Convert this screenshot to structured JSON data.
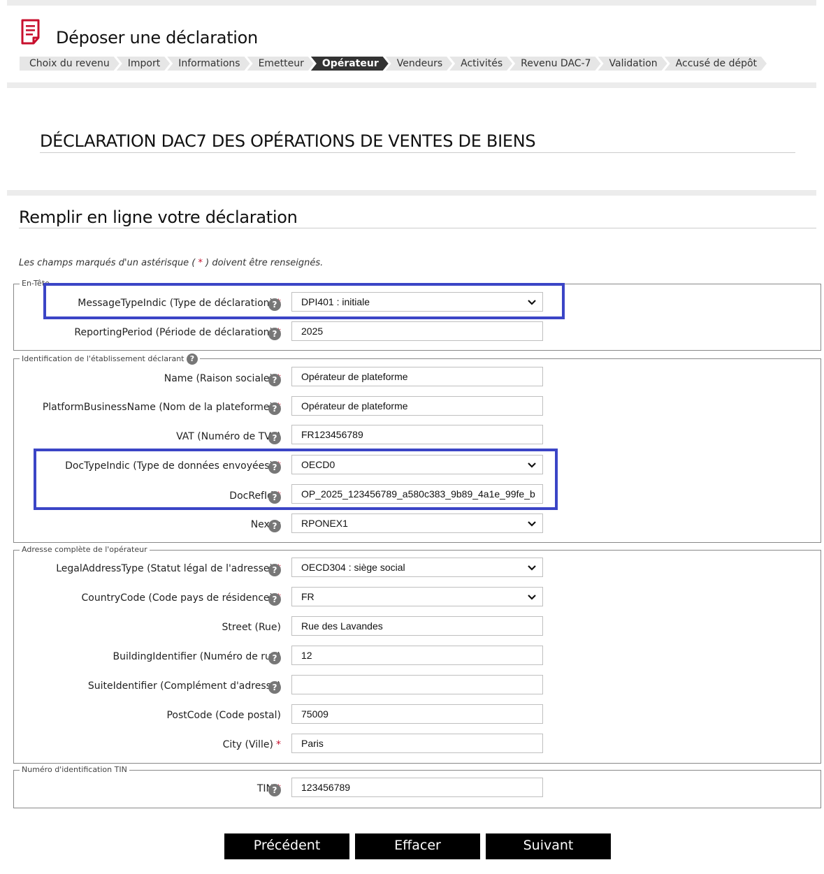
{
  "header": {
    "title": "Déposer une déclaration"
  },
  "steps": [
    {
      "label": "Choix du revenu",
      "active": false
    },
    {
      "label": "Import",
      "active": false
    },
    {
      "label": "Informations",
      "active": false
    },
    {
      "label": "Emetteur",
      "active": false
    },
    {
      "label": "Opérateur",
      "active": true
    },
    {
      "label": "Vendeurs",
      "active": false
    },
    {
      "label": "Activités",
      "active": false
    },
    {
      "label": "Revenu DAC-7",
      "active": false
    },
    {
      "label": "Validation",
      "active": false
    },
    {
      "label": "Accusé de dépôt",
      "active": false
    }
  ],
  "declaration_title": "DÉCLARATION DAC7 DES OPÉRATIONS DE VENTES DE BIENS",
  "form_title": "Remplir en ligne votre déclaration",
  "note": {
    "before": "Les champs marqués d'un astérisque ( ",
    "star": "*",
    "after": " ) doivent être renseignés."
  },
  "sections": {
    "header": {
      "legend": "En-Tête"
    },
    "identification": {
      "legend": "Identification de l'établissement déclarant"
    },
    "address": {
      "legend": "Adresse complète de l'opérateur"
    },
    "tin": {
      "legend": "Numéro d'identification TIN"
    }
  },
  "fields": {
    "message_type": {
      "label": "MessageTypeIndic (Type de déclaration)",
      "value": "DPI401 : initiale"
    },
    "reporting_period": {
      "label": "ReportingPeriod (Période de déclaration)",
      "value": "2025"
    },
    "name": {
      "label": "Name (Raison sociale)",
      "value": "Opérateur de plateforme"
    },
    "platform_business_name": {
      "label": "PlatformBusinessName (Nom de la plateforme)",
      "value": "Opérateur de plateforme"
    },
    "vat": {
      "label": "VAT (Numéro de TVA)",
      "value": "FR123456789"
    },
    "doc_type": {
      "label": "DocTypeIndic (Type de données envoyées)",
      "value": "OECD0"
    },
    "doc_ref": {
      "label": "DocRefId",
      "value": "OP_2025_123456789_a580c383_9b89_4a1e_99fe_b"
    },
    "nexus": {
      "label": "Nexus",
      "value": "RPONEX1"
    },
    "legal_address_type": {
      "label": "LegalAddressType (Statut légal de l'adresse)",
      "value": "OECD304 : siège social"
    },
    "country_code": {
      "label": "CountryCode (Code pays de résidence)",
      "value": "FR"
    },
    "street": {
      "label": "Street (Rue)",
      "value": "Rue des Lavandes"
    },
    "building_identifier": {
      "label": "BuildingIdentifier (Numéro de rue)",
      "value": "12"
    },
    "suite_identifier": {
      "label": "SuiteIdentifier (Complément d'adresse)",
      "value": ""
    },
    "post_code": {
      "label": "PostCode (Code postal)",
      "value": "75009"
    },
    "city": {
      "label": "City (Ville)",
      "value": "Paris"
    },
    "tin": {
      "label": "TIN",
      "value": "123456789"
    }
  },
  "required_mark": "*",
  "help_glyph": "?",
  "buttons": {
    "previous": "Précédent",
    "clear": "Effacer",
    "next": "Suivant"
  },
  "colors": {
    "highlight": "#3b45c6",
    "required": "#c8102e",
    "active_step": "#333333",
    "button": "#000000"
  }
}
